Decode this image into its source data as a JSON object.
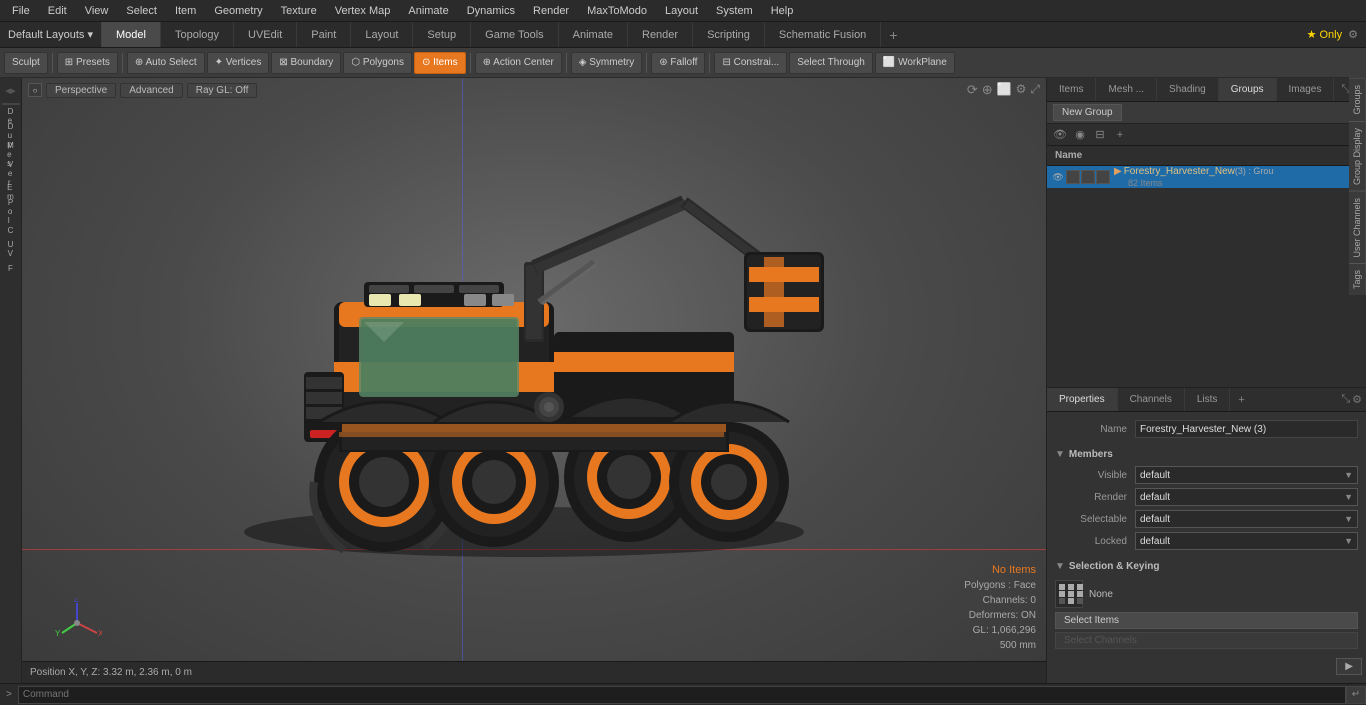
{
  "menu": {
    "items": [
      "File",
      "Edit",
      "View",
      "Select",
      "Item",
      "Geometry",
      "Texture",
      "Vertex Map",
      "Animate",
      "Dynamics",
      "Render",
      "MaxToModo",
      "Layout",
      "System",
      "Help"
    ]
  },
  "layout_bar": {
    "dropdown_label": "Default Layouts ▾",
    "tabs": [
      "Model",
      "Topology",
      "UVEdit",
      "Paint",
      "Layout",
      "Setup",
      "Game Tools",
      "Animate",
      "Render",
      "Scripting",
      "Schematic Fusion"
    ],
    "active_tab": "Model",
    "badge": "★ Only",
    "add_icon": "+"
  },
  "toolbar": {
    "sculpt_label": "Sculpt",
    "presets_label": "⊞ Presets",
    "auto_select_label": "⊕ Auto Select",
    "vertices_label": "✦ Vertices",
    "boundary_label": "⊠ Boundary",
    "polygons_label": "⬡ Polygons",
    "items_label": "⊙ Items",
    "action_center_label": "⊕ Action Center",
    "symmetry_label": "◈ Symmetry",
    "falloff_label": "⊛ Falloff",
    "constraints_label": "⊟ Constrai...",
    "select_through_label": "Select Through",
    "workplane_label": "⬜ WorkPlane"
  },
  "viewport": {
    "mode_label": "Perspective",
    "shading_label": "Advanced",
    "raygl_label": "Ray GL: Off",
    "status": {
      "no_items": "No Items",
      "polygons": "Polygons : Face",
      "channels": "Channels: 0",
      "deformers": "Deformers: ON",
      "gl_count": "GL: 1,066,296",
      "size": "500 mm"
    }
  },
  "scene_panel": {
    "tabs": [
      "Items",
      "Mesh ...",
      "Shading",
      "Groups",
      "Images"
    ],
    "active_tab": "Groups",
    "new_group_btn": "New Group",
    "column_header": "Name",
    "items": [
      {
        "name": "Forestry_Harvester_New",
        "suffix": " (3) : Grou",
        "sub": "82 Items",
        "selected": true
      }
    ]
  },
  "properties_panel": {
    "tabs": [
      "Properties",
      "Channels",
      "Lists"
    ],
    "active_tab": "Properties",
    "add_label": "+",
    "name_label": "Name",
    "name_value": "Forestry_Harvester_New (3)",
    "members_label": "Members",
    "fields": [
      {
        "label": "Visible",
        "value": "default"
      },
      {
        "label": "Render",
        "value": "default"
      },
      {
        "label": "Selectable",
        "value": "default"
      },
      {
        "label": "Locked",
        "value": "default"
      }
    ],
    "sel_keying_label": "Selection & Keying",
    "none_label": "None",
    "select_items_btn": "Select Items",
    "select_channels_btn": "Select Channels",
    "more_btn": "▶"
  },
  "command_bar": {
    "prompt": ">",
    "placeholder": "Command"
  },
  "right_edge_tabs": [
    "Groups",
    "Group Display",
    "User Channels",
    "Tags"
  ],
  "position_bar": {
    "label": "Position X, Y, Z:",
    "value": "3.32 m, 2.36 m, 0 m"
  },
  "left_sidebar": {
    "items": [
      "D",
      "e",
      "f",
      ".",
      "D",
      "u",
      "p",
      ".",
      "M",
      "e",
      "s",
      ".",
      "V",
      "e",
      "r",
      ".",
      "E",
      "m",
      ".",
      "P",
      "o",
      "l",
      ".",
      "C",
      ".",
      "U",
      "V",
      ".",
      "F",
      "."
    ]
  }
}
